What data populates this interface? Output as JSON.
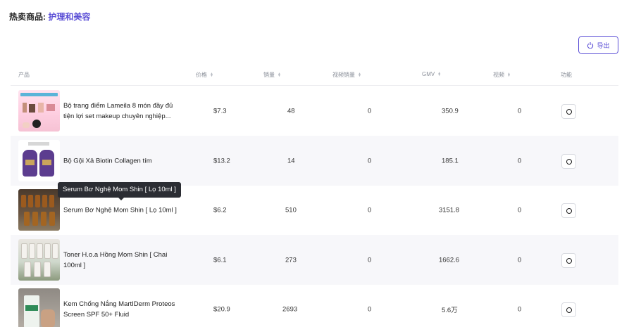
{
  "header": {
    "label": "热卖商品:",
    "category": "护理和美容"
  },
  "toolbar": {
    "export_label": "导出"
  },
  "table": {
    "columns": [
      "产品",
      "价格",
      "销量",
      "视频销量",
      "GMV",
      "视频",
      "功能"
    ],
    "rows": [
      {
        "name": "Bộ trang điểm Lameila 8 món đầy đủ tiện lợi set makeup chuyên nghiệp...",
        "price": "$7.3",
        "sales": "48",
        "video_sales": "0",
        "gmv": "350.9",
        "videos": "0"
      },
      {
        "name": "Bộ Gội Xả Biotin Collagen tím",
        "price": "$13.2",
        "sales": "14",
        "video_sales": "0",
        "gmv": "185.1",
        "videos": "0"
      },
      {
        "name": "Serum Bơ Nghệ Mom Shin [ Lọ 10ml ]",
        "price": "$6.2",
        "sales": "510",
        "video_sales": "0",
        "gmv": "3151.8",
        "videos": "0"
      },
      {
        "name": "Toner H.o.a Hồng Mom Shin [ Chai 100ml ]",
        "price": "$6.1",
        "sales": "273",
        "video_sales": "0",
        "gmv": "1662.6",
        "videos": "0"
      },
      {
        "name": "Kem Chống Nắng MartIDerm Proteos Screen SPF 50+ Fluid",
        "price": "$20.9",
        "sales": "2693",
        "video_sales": "0",
        "gmv": "5.6万",
        "videos": "0"
      }
    ]
  },
  "tooltip": {
    "text": "Serum Bơ Nghệ Mom Shin [ Lọ 10ml ]"
  },
  "colors": {
    "accent": "#5b4fd6",
    "row_alt": "#f7f7fa"
  }
}
